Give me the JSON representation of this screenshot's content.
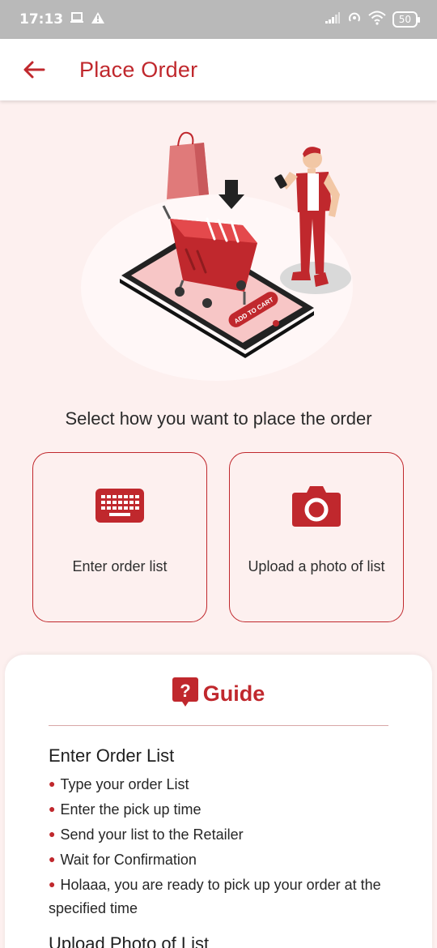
{
  "status_bar": {
    "time": "17:13",
    "battery": "50",
    "left_icons": [
      "laptop-icon",
      "warning-icon"
    ],
    "right_icons": [
      "signal-icon",
      "hotspot-icon",
      "wifi-icon",
      "battery-icon"
    ]
  },
  "app_bar": {
    "title": "Place Order",
    "back_icon": "arrow-left-icon"
  },
  "hero": {
    "cart_label": "ADD TO CART"
  },
  "prompt": "Select how you want to place the order",
  "options": [
    {
      "label": "Enter order list",
      "icon": "keyboard-icon"
    },
    {
      "label": "Upload a photo of list",
      "icon": "camera-icon"
    }
  ],
  "guide": {
    "title": "Guide",
    "icon": "question-icon",
    "sections": [
      {
        "title": "Enter Order List",
        "items": [
          "Type your order List",
          "Enter the pick up time",
          "Send your list to the Retailer",
          "Wait for Confirmation",
          "Holaaa, you are ready to pick up your order at the specified time"
        ]
      },
      {
        "title": "Upload Photo of List",
        "items": []
      }
    ]
  },
  "colors": {
    "accent": "#c0282d",
    "background": "#fdf0ef",
    "status_bar": "#b9b9b9"
  }
}
